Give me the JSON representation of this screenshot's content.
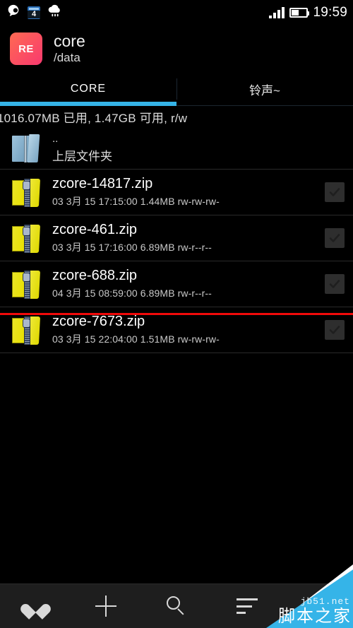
{
  "statusbar": {
    "icons": [
      "qq-icon",
      "calendar-icon",
      "weather-rain-icon"
    ],
    "calendar_day": "4",
    "signal": "signal-icon",
    "battery": "battery-icon",
    "clock": "19:59"
  },
  "header": {
    "app_icon_label": "RE",
    "title": "core",
    "subtitle": "/data",
    "accent": "#35b4e8",
    "icon_color": "#f8396f"
  },
  "tabs": [
    {
      "label": "CORE",
      "active": true
    },
    {
      "label": "铃声~",
      "active": false
    }
  ],
  "storage": {
    "text": "1016.07MB 已用, 1.47GB 可用, r/w"
  },
  "parent_row": {
    "name": "..",
    "desc": "上层文件夹",
    "icon": "blue-folder-icon"
  },
  "files": [
    {
      "name": "zcore-14817.zip",
      "meta": "03 3月 15 17:15:00  1.44MB  rw-rw-rw-",
      "date": "03 3月 15",
      "time": "17:15:00",
      "size": "1.44MB",
      "perms": "rw-rw-rw-",
      "icon": "zip-folder-icon",
      "checkbox": "checkbox-icon"
    },
    {
      "name": "zcore-461.zip",
      "meta": "03 3月 15 17:16:00  6.89MB  rw-r--r--",
      "date": "03 3月 15",
      "time": "17:16:00",
      "size": "6.89MB",
      "perms": "rw-r--r--",
      "icon": "zip-folder-icon",
      "checkbox": "checkbox-icon"
    },
    {
      "name": "zcore-688.zip",
      "meta": "04 3月 15 08:59:00  6.89MB  rw-r--r--",
      "date": "04 3月 15",
      "time": "08:59:00",
      "size": "6.89MB",
      "perms": "rw-r--r--",
      "icon": "zip-folder-icon",
      "checkbox": "checkbox-icon"
    },
    {
      "name": "zcore-7673.zip",
      "meta": "03 3月 15 22:04:00  1.51MB  rw-rw-rw-",
      "date": "03 3月 15",
      "time": "22:04:00",
      "size": "1.51MB",
      "perms": "rw-rw-rw-",
      "icon": "zip-folder-icon",
      "checkbox": "checkbox-icon"
    }
  ],
  "annotation": {
    "color": "#f10a0a",
    "target": "zcore-688.zip"
  },
  "toolbar": [
    {
      "name": "favorite-button",
      "icon": "heart-icon"
    },
    {
      "name": "add-button",
      "icon": "plus-icon"
    },
    {
      "name": "search-button",
      "icon": "search-icon"
    },
    {
      "name": "sort-button",
      "icon": "sort-icon"
    },
    {
      "name": "close-button",
      "icon": "x-icon"
    }
  ],
  "watermark": {
    "url": "jb51.net",
    "site": "脚本之家",
    "color": "#35b4e8"
  }
}
